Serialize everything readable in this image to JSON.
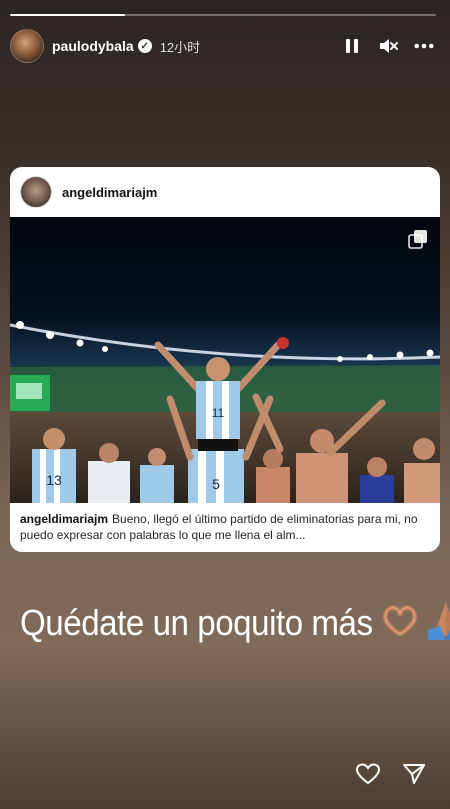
{
  "story": {
    "progress": 0.27,
    "username": "paulodybala",
    "timestamp": "12小时",
    "verified_icon": "verified-check-icon",
    "controls": {
      "pause_icon": "pause-icon",
      "mute_icon": "muted-speaker-icon",
      "more_icon": "more-icon"
    }
  },
  "shared_post": {
    "username": "angeldimariajm",
    "caption_user": "angeldimariajm",
    "caption_text": "Bueno, llegó el último partido de eliminatorias para mi, no puedo expresar con palabras lo que me llena el alm...",
    "player_numbers": [
      "11",
      "5",
      "13"
    ],
    "multi_image_icon": "multiple-images-icon"
  },
  "overlay": {
    "text": "Quédate un poquito más",
    "emojis": [
      "heart-hands-emoji",
      "folded-hands-emoji"
    ]
  },
  "footer": {
    "like_icon": "heart-icon",
    "share_icon": "send-icon"
  }
}
